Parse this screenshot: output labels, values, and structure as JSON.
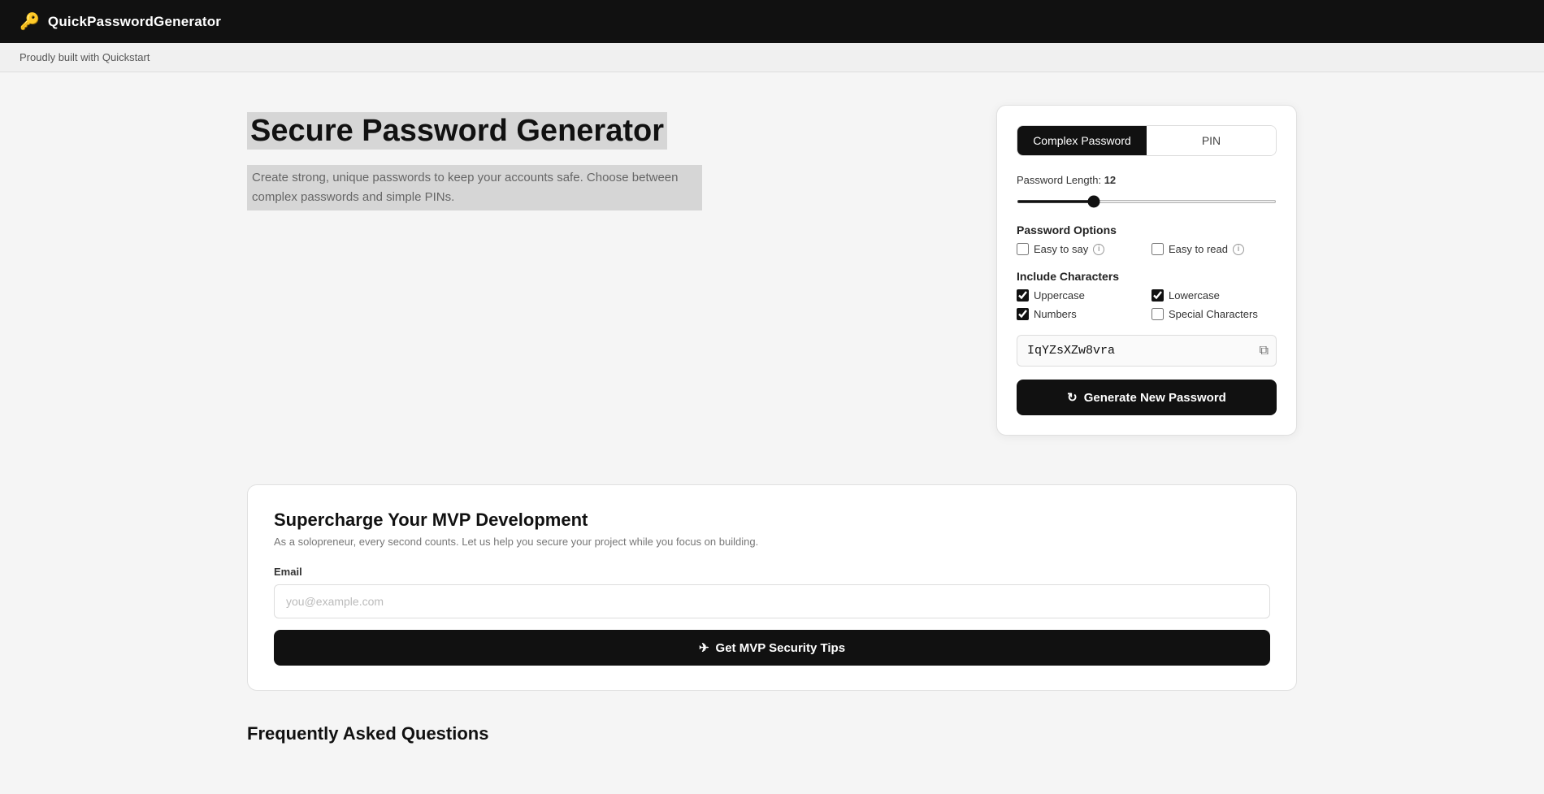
{
  "navbar": {
    "icon": "🔑",
    "title": "QuickPasswordGenerator",
    "subtext": "Proudly built with Quickstart"
  },
  "hero": {
    "title": "Secure Password Generator",
    "subtitle": "Create strong, unique passwords to keep your accounts safe. Choose between complex passwords and simple PINs."
  },
  "generator": {
    "tabs": [
      {
        "id": "complex",
        "label": "Complex Password",
        "active": true
      },
      {
        "id": "pin",
        "label": "PIN",
        "active": false
      }
    ],
    "length_label": "Password Length:",
    "length_value": "12",
    "length_min": "4",
    "length_max": "32",
    "options_label": "Password Options",
    "options": [
      {
        "id": "easy-say",
        "label": "Easy to say",
        "checked": false,
        "info": true
      },
      {
        "id": "easy-read",
        "label": "Easy to read",
        "checked": false,
        "info": true
      }
    ],
    "include_label": "Include Characters",
    "include_options": [
      {
        "id": "uppercase",
        "label": "Uppercase",
        "checked": true
      },
      {
        "id": "lowercase",
        "label": "Lowercase",
        "checked": true
      },
      {
        "id": "numbers",
        "label": "Numbers",
        "checked": true
      },
      {
        "id": "special",
        "label": "Special Characters",
        "checked": false
      }
    ],
    "generated_password": "IqYZsXZw8vra",
    "generate_btn_label": "Generate New Password",
    "copy_icon": "⧉"
  },
  "promo": {
    "title": "Supercharge Your MVP Development",
    "subtitle": "As a solopreneur, every second counts. Let us help you secure your project while you focus on building.",
    "email_label": "Email",
    "email_placeholder": "you@example.com",
    "btn_label": "Get MVP Security Tips",
    "btn_icon": "✈"
  },
  "faq": {
    "title": "Frequently Asked Questions"
  }
}
